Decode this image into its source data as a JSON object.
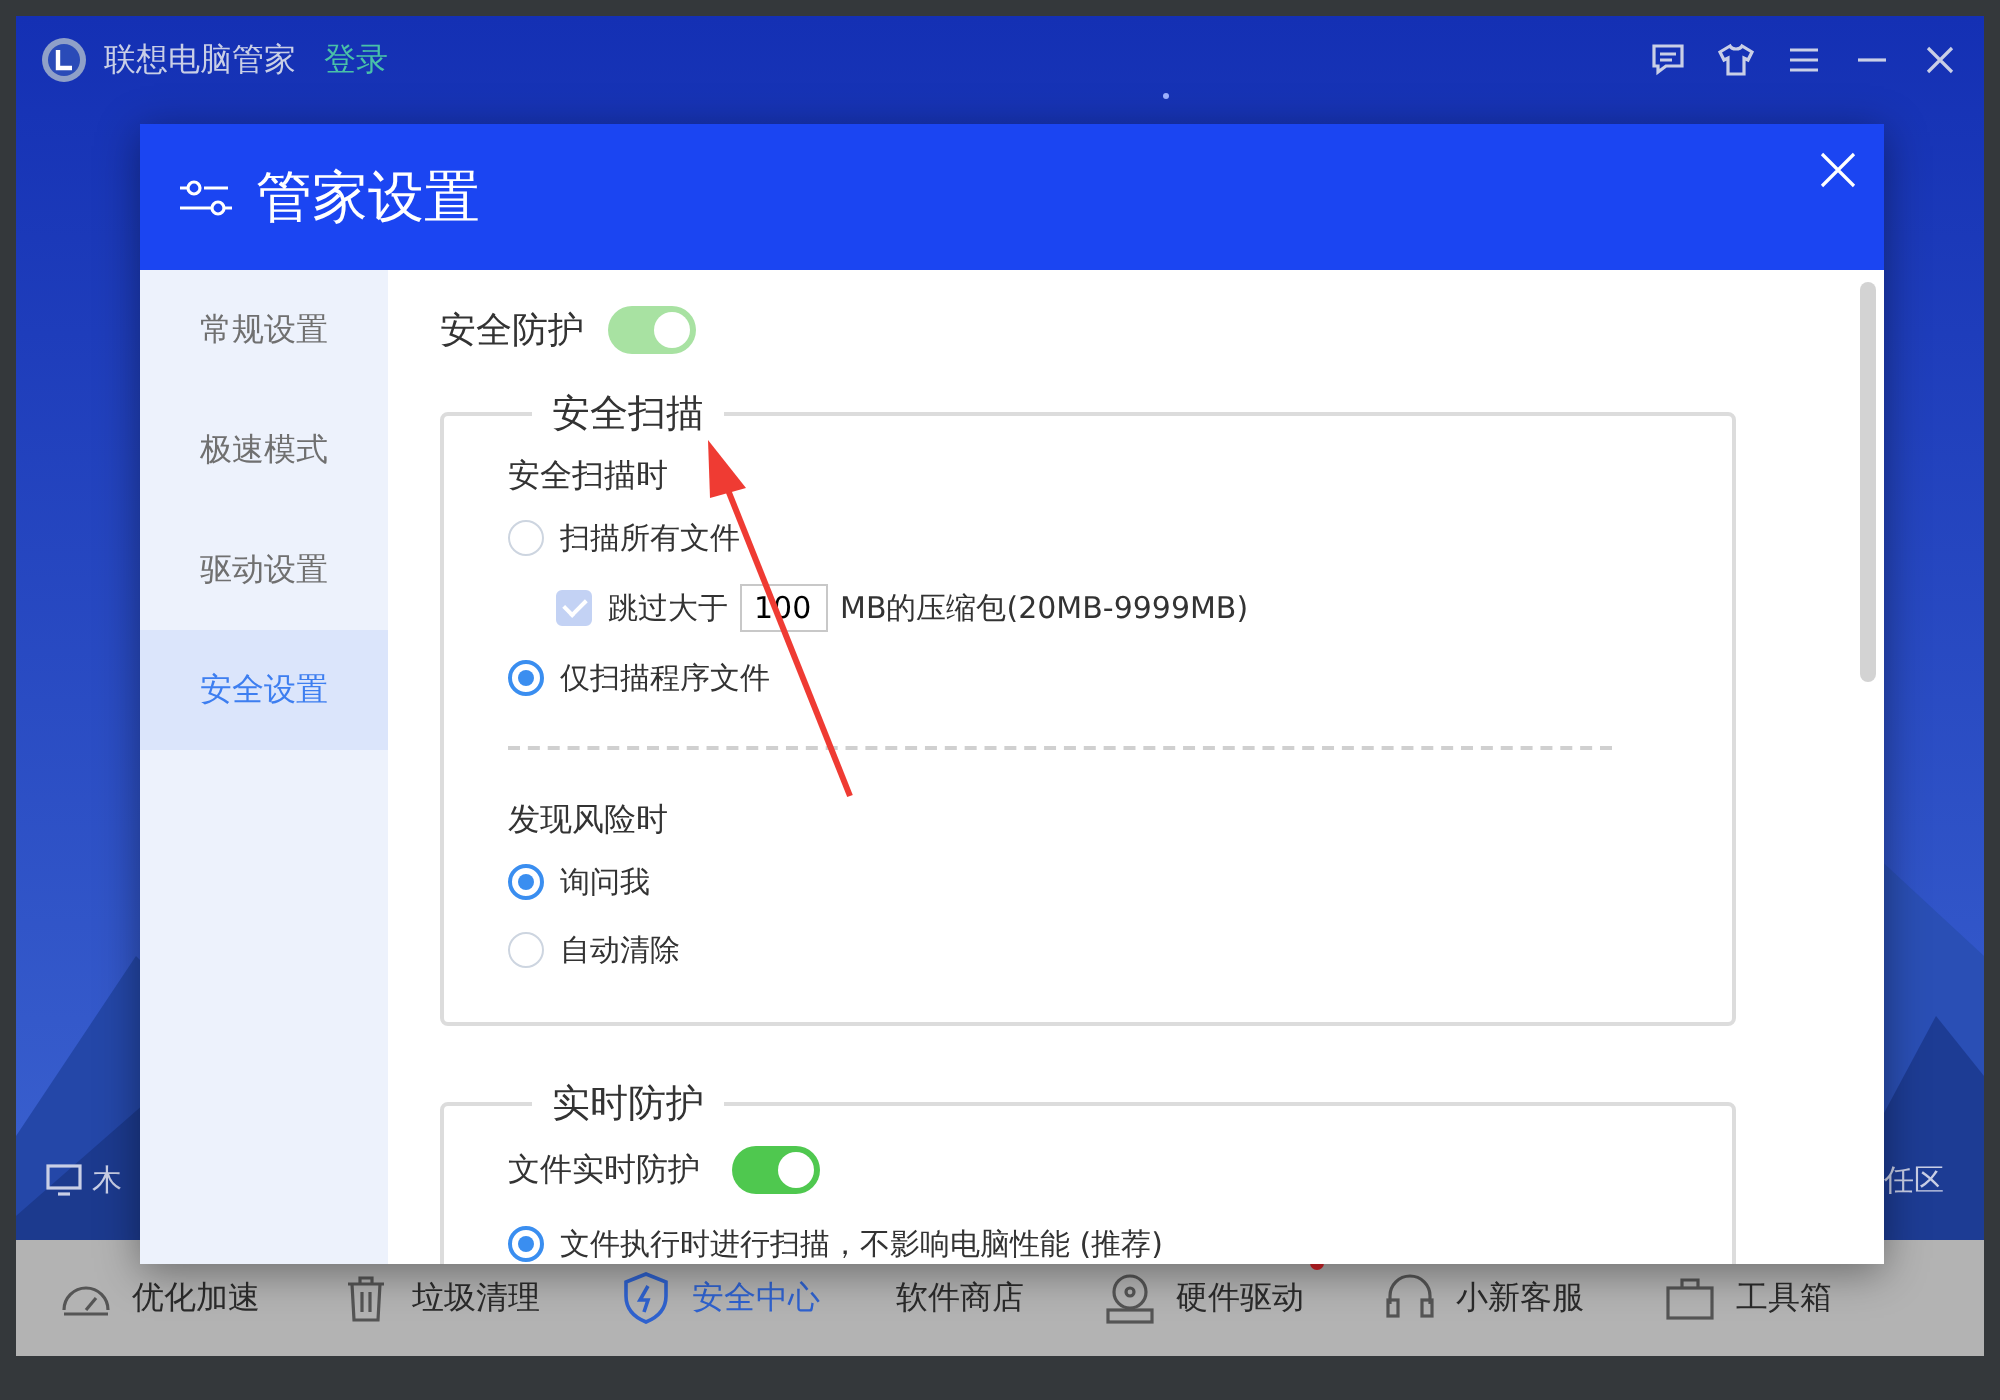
{
  "app": {
    "title": "联想电脑管家",
    "login": "登录"
  },
  "background_items": [
    {
      "label": "木"
    },
    {
      "label": "任区"
    }
  ],
  "nav": [
    {
      "label": "优化加速",
      "selected": false,
      "badge": false
    },
    {
      "label": "垃圾清理",
      "selected": false,
      "badge": false
    },
    {
      "label": "安全中心",
      "selected": true,
      "badge": false
    },
    {
      "label": "软件商店",
      "selected": false,
      "badge": false
    },
    {
      "label": "硬件驱动",
      "selected": false,
      "badge": true
    },
    {
      "label": "小新客服",
      "selected": false,
      "badge": false
    },
    {
      "label": "工具箱",
      "selected": false,
      "badge": false
    }
  ],
  "dialog": {
    "title": "管家设置",
    "sidebar": [
      {
        "label": "常规设置",
        "selected": false
      },
      {
        "label": "极速模式",
        "selected": false
      },
      {
        "label": "驱动设置",
        "selected": false
      },
      {
        "label": "安全设置",
        "selected": true
      }
    ],
    "master": {
      "label": "安全防护",
      "on": true,
      "disabled": true
    },
    "groups": [
      {
        "title": "安全扫描",
        "rows": [
          {
            "kind": "heading",
            "text": "安全扫描时"
          },
          {
            "kind": "radio",
            "label": "扫描所有文件",
            "selected": false
          },
          {
            "kind": "limit",
            "before": "跳过大于",
            "value": "100",
            "after": "MB的压缩包(20MB-9999MB)",
            "checked": true,
            "disabled": true
          },
          {
            "kind": "radio",
            "label": "仅扫描程序文件",
            "selected": true
          },
          {
            "kind": "divider"
          },
          {
            "kind": "heading",
            "text": "发现风险时"
          },
          {
            "kind": "radio",
            "label": "询问我",
            "selected": true
          },
          {
            "kind": "radio",
            "label": "自动清除",
            "selected": false
          }
        ]
      },
      {
        "title": "实时防护",
        "rows": [
          {
            "kind": "toggle",
            "label": "文件实时防护",
            "on": true,
            "disabled": false
          },
          {
            "kind": "radio",
            "label": "文件执行时进行扫描，不影响电脑性能 (推荐)",
            "selected": true
          }
        ]
      }
    ]
  },
  "annotation": {
    "kind": "arrow"
  }
}
